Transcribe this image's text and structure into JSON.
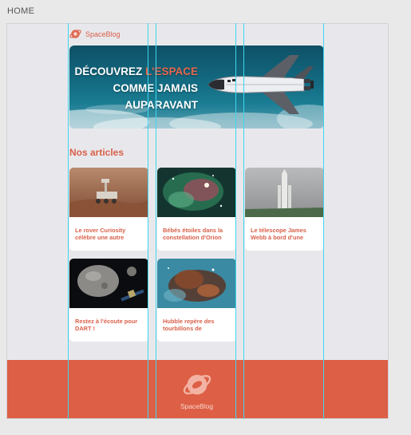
{
  "frame": {
    "label": "HOME"
  },
  "header": {
    "brand": "SpaceBlog",
    "logo_icon": "spaceblog-logo-icon"
  },
  "hero": {
    "line1_a": "DÉCOUVREZ",
    "line1_b": "L'ESPACE",
    "line2": "COMME JAMAIS",
    "line3": "AUPARAVANT",
    "image_icon": "space-shuttle-icon"
  },
  "section": {
    "title": "Nos articles"
  },
  "articles": [
    {
      "title": "Le rover Curiosity célèbre une autre"
    },
    {
      "title": "Bébés étoiles dans la constellation d'Orion"
    },
    {
      "title": "Le télescope James Webb à bord d'une"
    },
    {
      "title": "Restez à l'écoute pour DART !"
    },
    {
      "title": "Hubble repère des tourbillons de"
    }
  ],
  "footer": {
    "brand": "SpaceBlog"
  },
  "colors": {
    "accent": "#dd5f45",
    "background": "#e8e8ec",
    "guide": "#3fd6ee"
  }
}
